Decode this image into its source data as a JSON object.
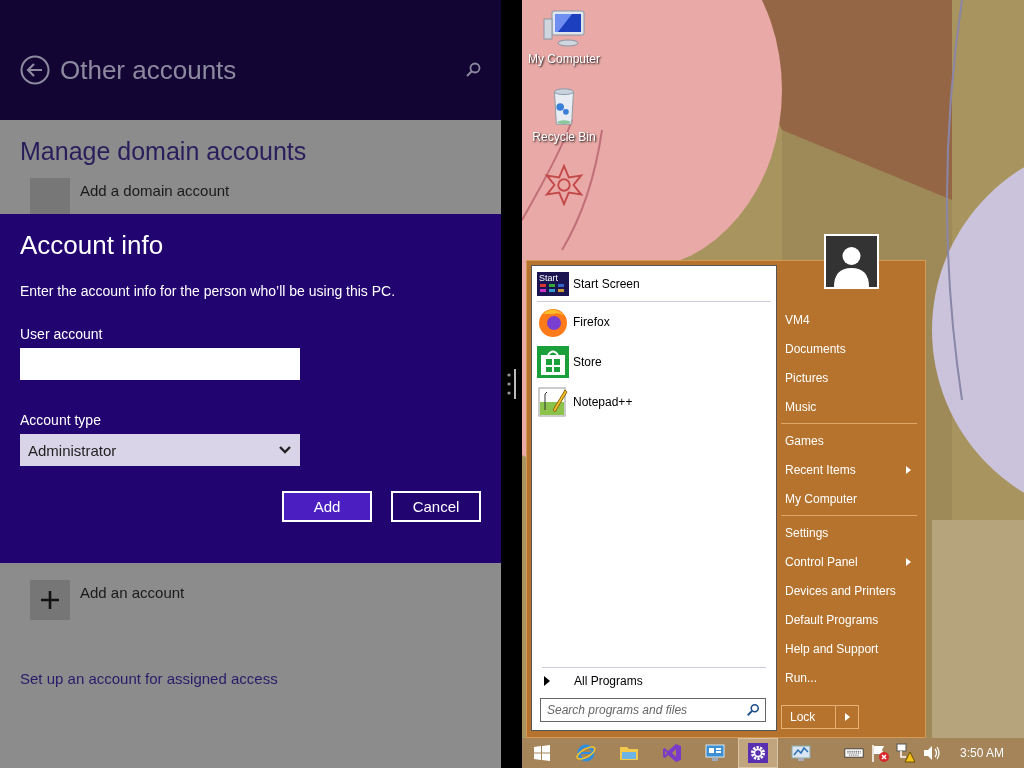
{
  "settings_panel": {
    "title": "Other accounts",
    "section_title": "Manage domain accounts",
    "domain_action": "Add a domain account",
    "add_action": "Add an account",
    "link": "Set up an account for assigned access"
  },
  "dialog": {
    "title": "Account info",
    "description": "Enter the account info for the person who’ll be using this PC.",
    "fields": [
      {
        "kind": "text",
        "label": "User account"
      },
      {
        "kind": "select",
        "label": "Account type",
        "value": "Administrator"
      }
    ],
    "buttons": [
      {
        "label": "Add",
        "primary": true
      },
      {
        "label": "Cancel",
        "primary": false
      }
    ]
  },
  "desktop": {
    "icons": [
      {
        "kind": "computer",
        "label": "My Computer"
      },
      {
        "kind": "recycle-bin",
        "label": "Recycle Bin"
      },
      {
        "kind": "star"
      }
    ]
  },
  "start_menu": {
    "pinned": [
      {
        "kind": "start",
        "label": "Start Screen",
        "tile_text": "Start"
      },
      {
        "kind": "firefox",
        "label": "Firefox"
      },
      {
        "kind": "store",
        "label": "Store"
      },
      {
        "kind": "notepad",
        "label": "Notepad++"
      }
    ],
    "all_programs": "All Programs",
    "search": {
      "placeholder": "Search programs and files"
    },
    "places": [
      {
        "items": [
          {
            "label": "VM4",
            "submenu": false
          },
          {
            "label": "Documents",
            "submenu": false
          },
          {
            "label": "Pictures",
            "submenu": false
          },
          {
            "label": "Music",
            "submenu": false
          }
        ]
      },
      {
        "items": [
          {
            "label": "Games",
            "submenu": false
          },
          {
            "label": "Recent Items",
            "submenu": true
          },
          {
            "label": "My Computer",
            "submenu": false
          }
        ]
      },
      {
        "items": [
          {
            "label": "Settings",
            "submenu": false
          },
          {
            "label": "Control Panel",
            "submenu": true
          },
          {
            "label": "Devices and Printers",
            "submenu": false
          },
          {
            "label": "Default Programs",
            "submenu": false
          },
          {
            "label": "Help and Support",
            "submenu": false
          },
          {
            "label": "Run...",
            "submenu": false
          }
        ]
      }
    ],
    "power_button": "Lock"
  },
  "taskbar": {
    "apps": [
      {
        "kind": "ie",
        "selected": false
      },
      {
        "kind": "explorer",
        "selected": false
      },
      {
        "kind": "visual-studio",
        "selected": false
      },
      {
        "kind": "remote",
        "selected": false
      },
      {
        "kind": "settings",
        "selected": true
      },
      {
        "kind": "monitor",
        "selected": false
      }
    ],
    "tray": [
      {
        "kind": "keyboard"
      },
      {
        "kind": "flag"
      },
      {
        "kind": "network"
      },
      {
        "kind": "volume"
      }
    ],
    "clock": "3:50 AM"
  }
}
